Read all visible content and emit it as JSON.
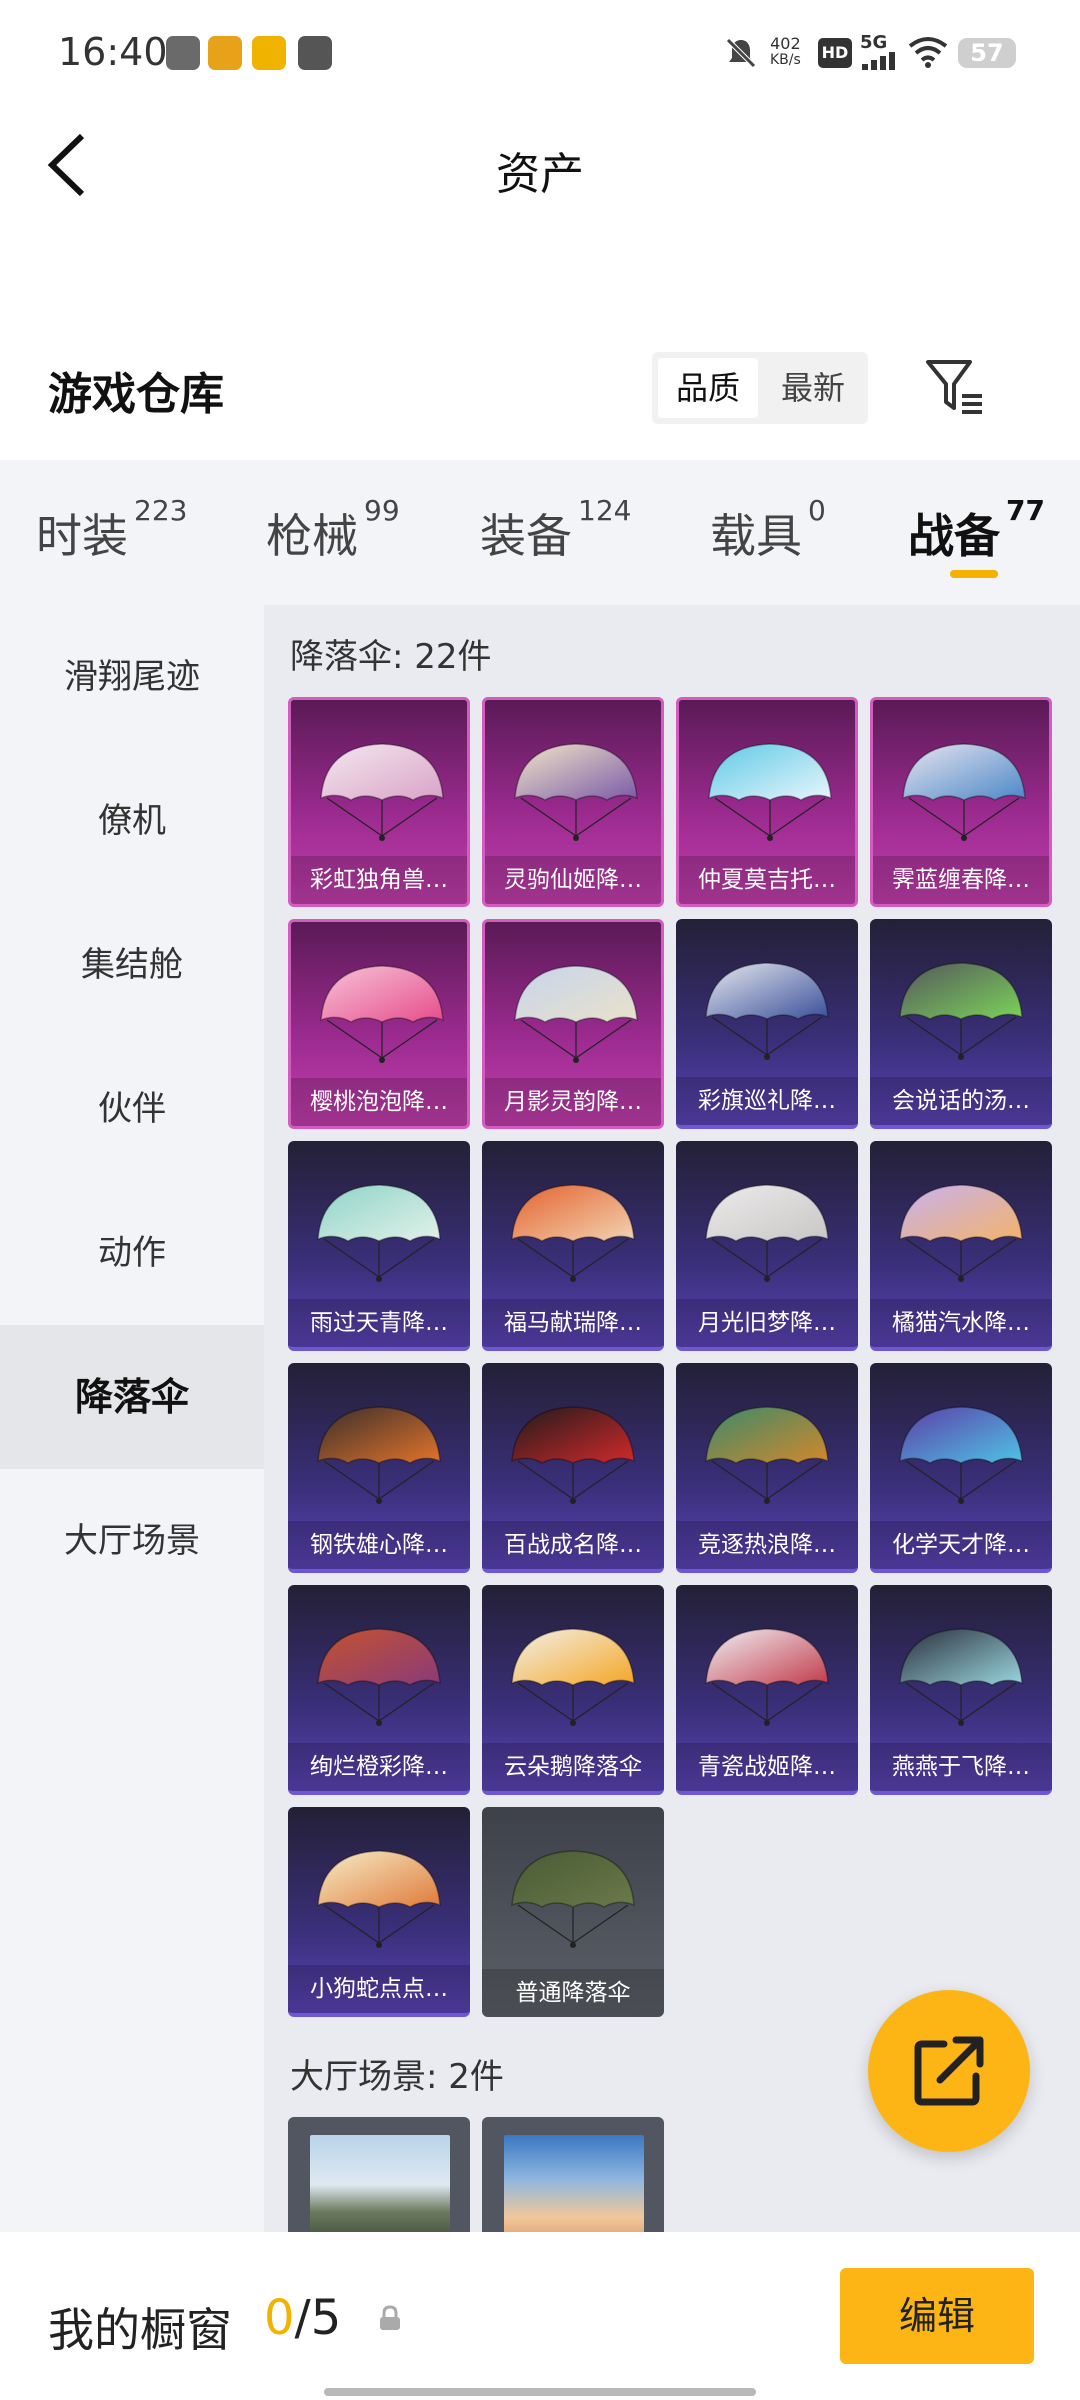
{
  "status_bar": {
    "time": "16:40",
    "net_speed": "402",
    "net_unit": "KB/s",
    "hd": "HD",
    "signal": "5G",
    "battery": "57",
    "icons": [
      "app-icon-1",
      "app-icon-2",
      "app-icon-3",
      "vivo-icon",
      "mute-icon",
      "hd-icon",
      "signal-5g-icon",
      "wifi-icon",
      "battery-icon"
    ]
  },
  "header": {
    "title": "资产",
    "back_icon": "chevron-left-icon"
  },
  "warehouse": {
    "title": "游戏仓库",
    "sort_quality": "品质",
    "sort_newest": "最新",
    "filter_icon": "filter-icon"
  },
  "tabs": [
    {
      "label": "时装",
      "count": "223"
    },
    {
      "label": "枪械",
      "count": "99"
    },
    {
      "label": "装备",
      "count": "124"
    },
    {
      "label": "载具",
      "count": "0"
    },
    {
      "label": "战备",
      "count": "77",
      "active": true
    }
  ],
  "sidebar": [
    {
      "label": "滑翔尾迹"
    },
    {
      "label": "僚机"
    },
    {
      "label": "集结舱"
    },
    {
      "label": "伙伴"
    },
    {
      "label": "动作"
    },
    {
      "label": "降落伞",
      "active": true
    },
    {
      "label": "大厅场景"
    }
  ],
  "sections": {
    "parachute_title": "降落伞: 22件",
    "scene_title": "大厅场景: 2件"
  },
  "items": [
    {
      "label": "彩虹独角兽…",
      "rarity": "pink",
      "color1": "#f4e8ef",
      "color2": "#d9a3c7"
    },
    {
      "label": "灵驹仙姬降…",
      "rarity": "pink",
      "color1": "#f2e6c8",
      "color2": "#7a5aa8"
    },
    {
      "label": "仲夏莫吉托…",
      "rarity": "pink",
      "color1": "#5ec9e6",
      "color2": "#e8f6fb"
    },
    {
      "label": "霁蓝缠春降…",
      "rarity": "pink",
      "color1": "#e9e4f0",
      "color2": "#4a88c7"
    },
    {
      "label": "樱桃泡泡降…",
      "rarity": "pink",
      "color1": "#f7c3d8",
      "color2": "#e64d8b"
    },
    {
      "label": "月影灵韵降…",
      "rarity": "pink",
      "color1": "#c8d4ef",
      "color2": "#e8e2c8"
    },
    {
      "label": "彩旗巡礼降…",
      "rarity": "purple",
      "color1": "#e6e8ee",
      "color2": "#3a4f9a"
    },
    {
      "label": "会说话的汤…",
      "rarity": "purple",
      "color1": "#55565c",
      "color2": "#7bd35a"
    },
    {
      "label": "雨过天青降…",
      "rarity": "purple",
      "color1": "#8fd4c8",
      "color2": "#e2f1e8"
    },
    {
      "label": "福马献瑞降…",
      "rarity": "purple",
      "color1": "#e4622e",
      "color2": "#f2d3b2"
    },
    {
      "label": "月光旧梦降…",
      "rarity": "purple",
      "color1": "#eceaea",
      "color2": "#c9c6c6"
    },
    {
      "label": "橘猫汽水降…",
      "rarity": "purple",
      "color1": "#c6b2ef",
      "color2": "#f4b36a"
    },
    {
      "label": "钢铁雄心降…",
      "rarity": "purple",
      "color1": "#3a2e2c",
      "color2": "#e2742a"
    },
    {
      "label": "百战成名降…",
      "rarity": "purple",
      "color1": "#1f1a1c",
      "color2": "#d12a2a"
    },
    {
      "label": "竞逐热浪降…",
      "rarity": "purple",
      "color1": "#3b8a6a",
      "color2": "#d2882c"
    },
    {
      "label": "化学天才降…",
      "rarity": "purple",
      "color1": "#5a3ea6",
      "color2": "#4fc3e6"
    },
    {
      "label": "绚烂橙彩降…",
      "rarity": "purple",
      "color1": "#c4532e",
      "color2": "#8a3a7a"
    },
    {
      "label": "云朵鹅降落伞",
      "rarity": "purple",
      "color1": "#f2f0ea",
      "color2": "#f5a623"
    },
    {
      "label": "青瓷战姬降…",
      "rarity": "purple",
      "color1": "#f0f1f5",
      "color2": "#c23a4a"
    },
    {
      "label": "燕燕于飞降…",
      "rarity": "purple",
      "color1": "#2a2e3a",
      "color2": "#9ad7e0"
    },
    {
      "label": "小狗蛇点点…",
      "rarity": "purple",
      "color1": "#f6edc8",
      "color2": "#e07a3a"
    },
    {
      "label": "普通降落伞",
      "rarity": "gray",
      "color1": "#4a5a34",
      "color2": "#6a7a4a"
    }
  ],
  "scenes": [
    {
      "kind": "mountain-scene"
    },
    {
      "kind": "sky-scene"
    }
  ],
  "fab": {
    "icon": "share-external-icon"
  },
  "showcase": {
    "title": "我的橱窗",
    "current": "0",
    "separator": "/",
    "total": "5",
    "lock_icon": "lock-icon",
    "edit_label": "编辑"
  }
}
